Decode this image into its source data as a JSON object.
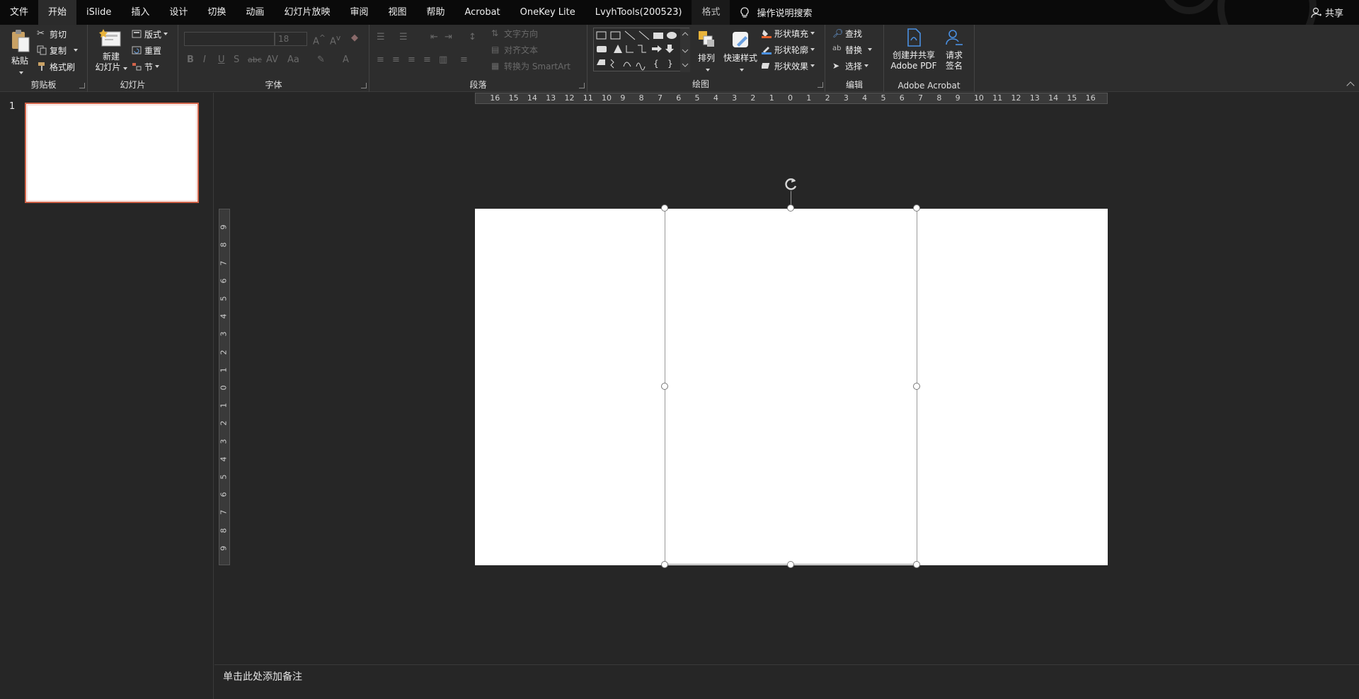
{
  "menubar": {
    "tabs": [
      {
        "label": "文件"
      },
      {
        "label": "开始",
        "active": true
      },
      {
        "label": "iSlide"
      },
      {
        "label": "插入"
      },
      {
        "label": "设计"
      },
      {
        "label": "切换"
      },
      {
        "label": "动画"
      },
      {
        "label": "幻灯片放映"
      },
      {
        "label": "审阅"
      },
      {
        "label": "视图"
      },
      {
        "label": "帮助"
      },
      {
        "label": "Acrobat"
      },
      {
        "label": "OneKey Lite"
      },
      {
        "label": "LvyhTools(200523)"
      },
      {
        "label": "格式",
        "context": true
      }
    ],
    "search_label": "操作说明搜索",
    "share_label": "共享"
  },
  "ribbon": {
    "clipboard": {
      "paste": "粘贴",
      "cut": "剪切",
      "copy": "复制",
      "format_painter": "格式刷",
      "group_label": "剪贴板"
    },
    "slides": {
      "new_slide_line1": "新建",
      "new_slide_line2": "幻灯片",
      "layout": "版式",
      "reset": "重置",
      "section": "节",
      "group_label": "幻灯片"
    },
    "font": {
      "font_name": "",
      "font_size": "18",
      "group_label": "字体"
    },
    "paragraph": {
      "text_direction": "文字方向",
      "align_text": "对齐文本",
      "convert_smartart": "转换为 SmartArt",
      "group_label": "段落"
    },
    "drawing": {
      "arrange": "排列",
      "quick_styles": "快速样式",
      "shape_fill": "形状填充",
      "shape_outline": "形状轮廓",
      "shape_effects": "形状效果",
      "group_label": "绘图"
    },
    "editing": {
      "find": "查找",
      "replace": "替换",
      "select": "选择",
      "group_label": "编辑"
    },
    "acrobat": {
      "create_share_line1": "创建并共享",
      "create_share_line2": "Adobe PDF",
      "request_sign_line1": "请求",
      "request_sign_line2": "签名",
      "group_label": "Adobe Acrobat"
    }
  },
  "thumbnails": {
    "slide_number": "1"
  },
  "ruler": {
    "horizontal": [
      "16",
      "15",
      "14",
      "13",
      "12",
      "11",
      "10",
      "9",
      "8",
      "7",
      "6",
      "5",
      "4",
      "3",
      "2",
      "1",
      "0",
      "1",
      "2",
      "3",
      "4",
      "5",
      "6",
      "7",
      "8",
      "9",
      "10",
      "11",
      "12",
      "13",
      "14",
      "15",
      "16"
    ],
    "vertical": [
      "9",
      "8",
      "7",
      "6",
      "5",
      "4",
      "3",
      "2",
      "1",
      "0",
      "1",
      "2",
      "3",
      "4",
      "5",
      "6",
      "7",
      "8",
      "9"
    ]
  },
  "notes": {
    "placeholder": "单击此处添加备注"
  },
  "colors": {
    "accent_selection": "#d16349",
    "menubar_bg": "#0a0a0a",
    "ribbon_bg": "#2d2d2d",
    "workspace_bg": "#262626"
  }
}
